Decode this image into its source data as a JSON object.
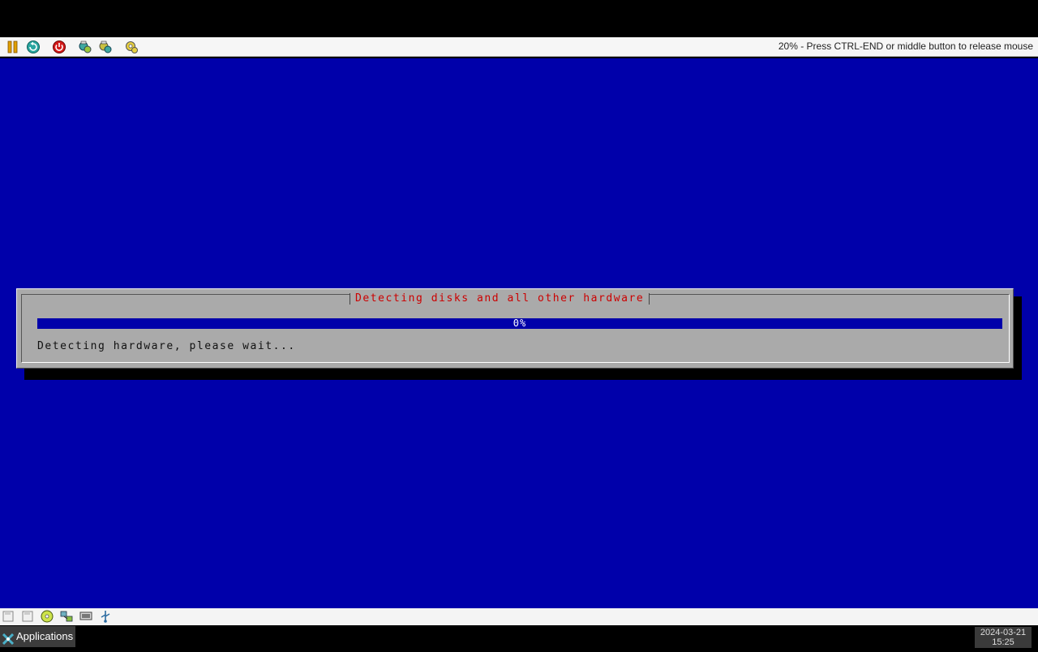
{
  "vm_toolbar": {
    "icons": [
      "pause-icon",
      "reset-icon",
      "power-icon",
      "snapshot-icon",
      "snapshot-revert-icon",
      "settings-icon"
    ],
    "status_text": "20% - Press CTRL-END or middle button to release mouse"
  },
  "installer": {
    "dialog_title": "Detecting disks and all other hardware",
    "progress": {
      "percent": 0,
      "label": "0%"
    },
    "message": "Detecting hardware, please wait..."
  },
  "bottom_toolbar": {
    "icons": [
      "floppy-icon",
      "floppy-b-icon",
      "cdrom-icon",
      "network-icon",
      "display-icon",
      "usb-icon"
    ]
  },
  "taskbar": {
    "applications_label": "Applications",
    "date": "2024-03-21",
    "time": "15:25"
  },
  "colors": {
    "screen_blue": "#0000aa",
    "dialog_gray": "#aaaaaa",
    "title_red": "#cc0000"
  }
}
